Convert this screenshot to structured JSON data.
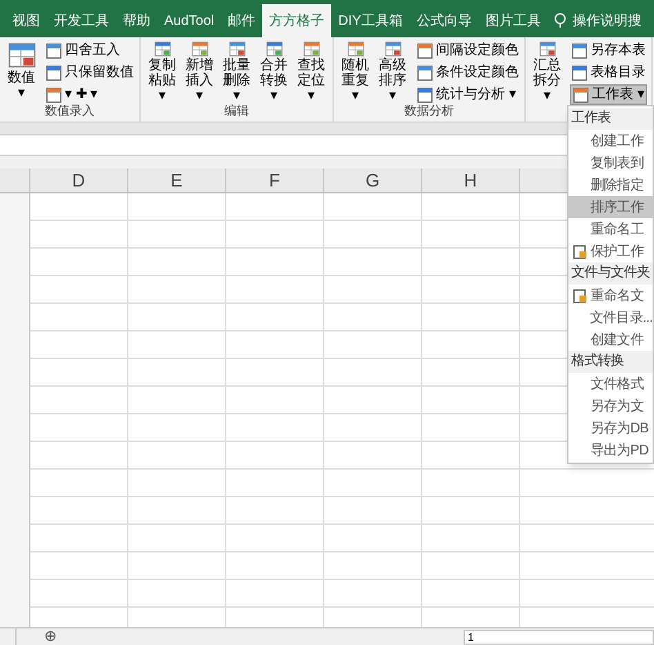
{
  "tabs": [
    {
      "label": "视图",
      "selected": false
    },
    {
      "label": "开发工具",
      "selected": false
    },
    {
      "label": "帮助",
      "selected": false
    },
    {
      "label": "AudTool",
      "selected": false
    },
    {
      "label": "邮件",
      "selected": false
    },
    {
      "label": "方方格子",
      "selected": true
    },
    {
      "label": "DIY工具箱",
      "selected": false
    },
    {
      "label": "公式向导",
      "selected": false
    },
    {
      "label": "图片工具",
      "selected": false
    }
  ],
  "search": {
    "placeholder": "操作说明搜"
  },
  "groups": [
    {
      "label": "数值录入",
      "large": [
        {
          "label": "数值",
          "caret": "▾"
        }
      ],
      "small": [
        {
          "label": "四舍五入"
        },
        {
          "label": "只保留数值"
        },
        {
          "label": "▾ ✚ ▾"
        }
      ]
    },
    {
      "label": "编辑",
      "large": [
        {
          "label": "复制粘贴 ▾"
        },
        {
          "label": "新增插入 ▾"
        },
        {
          "label": "批量删除 ▾"
        },
        {
          "label": "合并转换 ▾"
        },
        {
          "label": "查找定位 ▾"
        }
      ]
    },
    {
      "label": "数据分析",
      "large": [
        {
          "label": "随机重复 ▾"
        },
        {
          "label": "高级排序 ▾"
        }
      ],
      "small": [
        {
          "label": "间隔设定颜色"
        },
        {
          "label": "条件设定颜色"
        },
        {
          "label": "统计与分析 ▾"
        }
      ]
    },
    {
      "large": [
        {
          "label": "汇总拆分 ▾"
        }
      ],
      "small": [
        {
          "label": "另存本表"
        },
        {
          "label": "表格目录"
        },
        {
          "label": "工作表 ▾",
          "pressed": true
        }
      ]
    }
  ],
  "columns": [
    "D",
    "E",
    "F",
    "G",
    "H"
  ],
  "menu": [
    {
      "kind": "header",
      "label": "工作表"
    },
    {
      "kind": "item",
      "label": "创建工作",
      "selected": false,
      "has_icon": false
    },
    {
      "kind": "item",
      "label": "复制表到",
      "selected": false,
      "has_icon": false
    },
    {
      "kind": "item",
      "label": "删除指定",
      "selected": false,
      "has_icon": false
    },
    {
      "kind": "item",
      "label": "排序工作",
      "selected": true,
      "has_icon": false
    },
    {
      "kind": "item",
      "label": "重命名工",
      "selected": false,
      "has_icon": false
    },
    {
      "kind": "item",
      "label": "保护工作",
      "selected": false,
      "has_icon": true
    },
    {
      "kind": "header",
      "label": "文件与文件夹"
    },
    {
      "kind": "item",
      "label": "重命名文",
      "selected": false,
      "has_icon": true
    },
    {
      "kind": "item",
      "label": "文件目录...",
      "selected": false,
      "has_icon": false
    },
    {
      "kind": "item",
      "label": "创建文件",
      "selected": false,
      "has_icon": false
    },
    {
      "kind": "header",
      "label": "格式转换"
    },
    {
      "kind": "item",
      "label": "文件格式",
      "selected": false,
      "has_icon": false
    },
    {
      "kind": "item",
      "label": "另存为文",
      "selected": false,
      "has_icon": false
    },
    {
      "kind": "item",
      "label": "另存为DB",
      "selected": false,
      "has_icon": false
    },
    {
      "kind": "item",
      "label": "导出为PD",
      "selected": false,
      "has_icon": false
    }
  ],
  "status": {
    "add_sheet": "⊕",
    "page": "1"
  }
}
